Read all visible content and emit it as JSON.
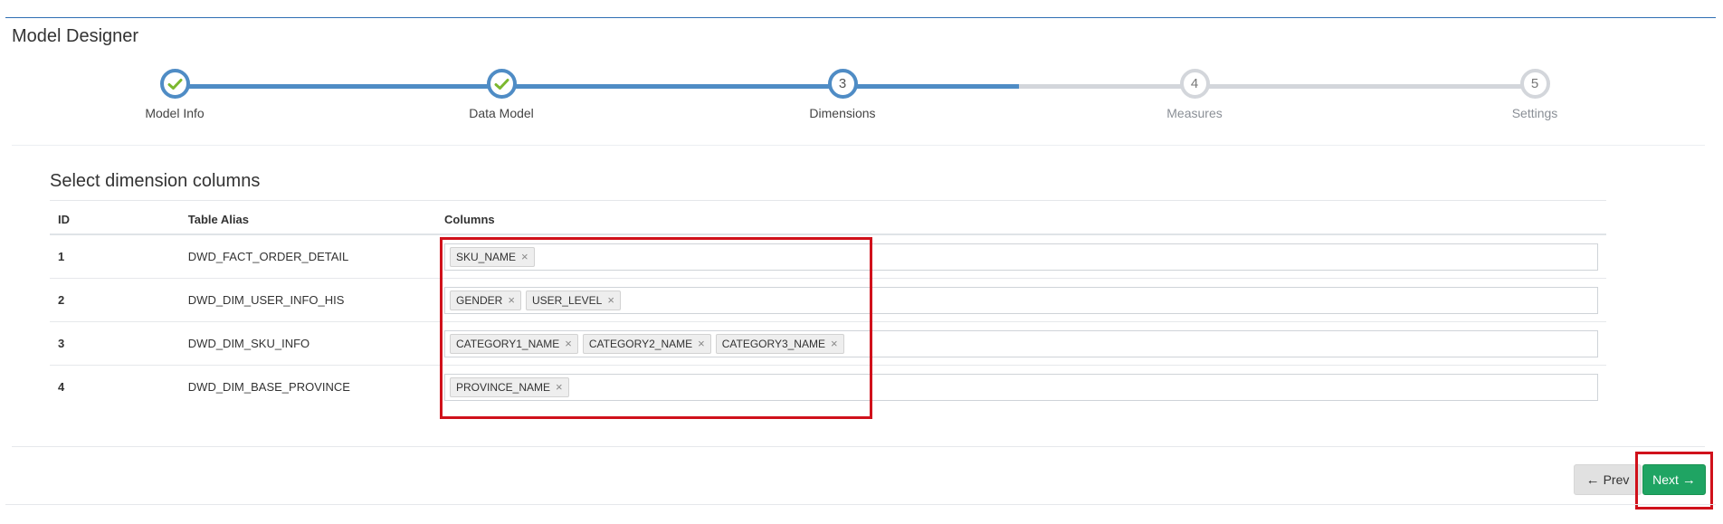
{
  "page_title": "Model Designer",
  "wizard": {
    "steps": [
      {
        "label": "Model Info",
        "state": "done",
        "number": "1"
      },
      {
        "label": "Data Model",
        "state": "done",
        "number": "2"
      },
      {
        "label": "Dimensions",
        "state": "active",
        "number": "3"
      },
      {
        "label": "Measures",
        "state": "todo",
        "number": "4"
      },
      {
        "label": "Settings",
        "state": "todo",
        "number": "5"
      }
    ]
  },
  "section_title": "Select dimension columns",
  "table": {
    "headers": {
      "id": "ID",
      "alias": "Table Alias",
      "columns": "Columns"
    },
    "rows": [
      {
        "id": "1",
        "alias": "DWD_FACT_ORDER_DETAIL",
        "tags": [
          "SKU_NAME"
        ]
      },
      {
        "id": "2",
        "alias": "DWD_DIM_USER_INFO_HIS",
        "tags": [
          "GENDER",
          "USER_LEVEL"
        ]
      },
      {
        "id": "3",
        "alias": "DWD_DIM_SKU_INFO",
        "tags": [
          "CATEGORY1_NAME",
          "CATEGORY2_NAME",
          "CATEGORY3_NAME"
        ]
      },
      {
        "id": "4",
        "alias": "DWD_DIM_BASE_PROVINCE",
        "tags": [
          "PROVINCE_NAME"
        ]
      }
    ]
  },
  "buttons": {
    "prev": "Prev",
    "next": "Next"
  },
  "colors": {
    "accent": "#4f8cc5",
    "success": "#1fa463",
    "highlight": "#d0111b",
    "check": "#7cb82f"
  },
  "icons": {
    "step_done": "check-icon",
    "remove_tag": "close-icon",
    "prev": "arrow-left-icon",
    "next": "arrow-right-icon"
  }
}
